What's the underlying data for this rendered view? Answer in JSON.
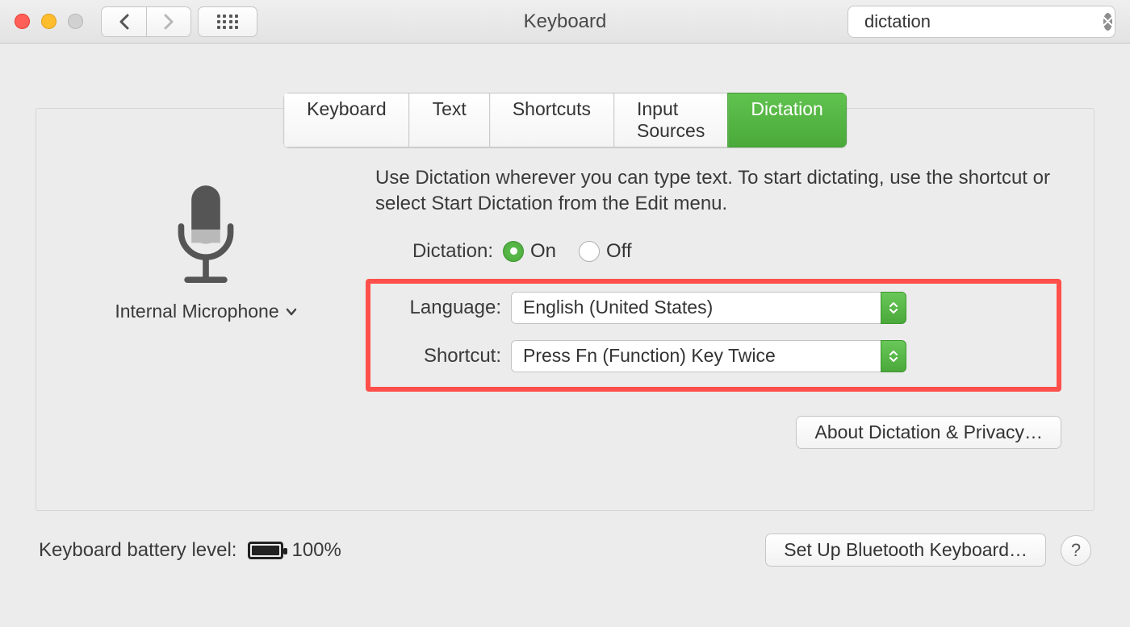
{
  "window": {
    "title": "Keyboard"
  },
  "search": {
    "value": "dictation"
  },
  "tabs": {
    "t0": "Keyboard",
    "t1": "Text",
    "t2": "Shortcuts",
    "t3": "Input Sources",
    "t4": "Dictation"
  },
  "mic": {
    "label": "Internal Microphone"
  },
  "description": "Use Dictation wherever you can type text. To start dictating, use the shortcut or select Start Dictation from the Edit menu.",
  "rows": {
    "dictation_label": "Dictation:",
    "on_label": "On",
    "off_label": "Off",
    "language_label": "Language:",
    "language_value": "English (United States)",
    "shortcut_label": "Shortcut:",
    "shortcut_value": "Press Fn (Function) Key Twice"
  },
  "buttons": {
    "about": "About Dictation & Privacy…",
    "bluetooth": "Set Up Bluetooth Keyboard…",
    "help": "?"
  },
  "footer": {
    "battery_label": "Keyboard battery level:",
    "battery_pct": "100%"
  }
}
